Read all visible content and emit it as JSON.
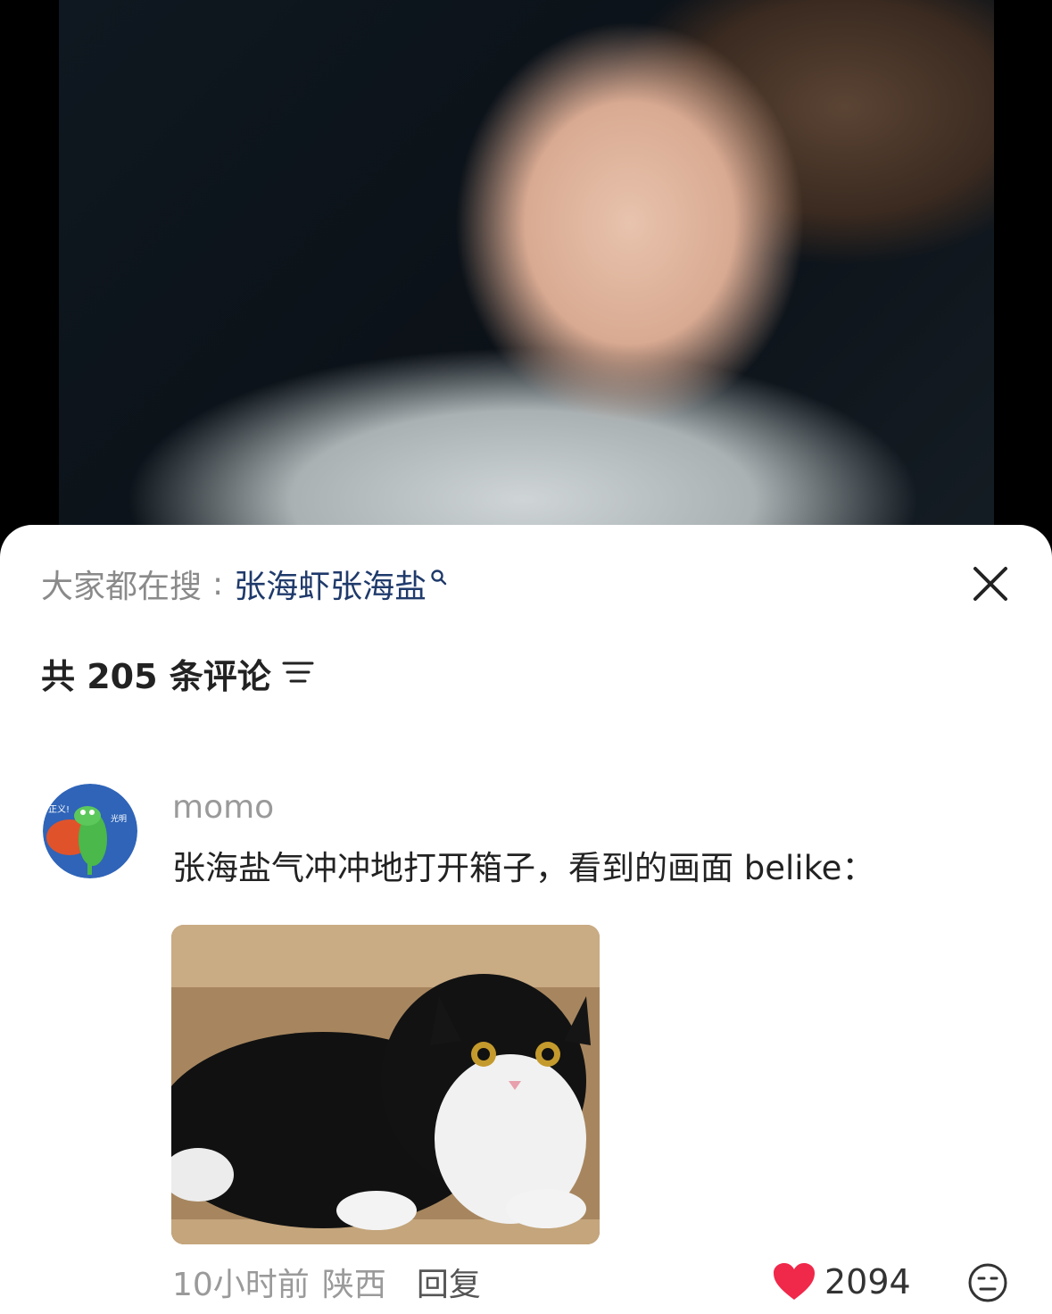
{
  "search_hint": {
    "prefix": "大家都在搜",
    "colon": ":",
    "term": "张海虾张海盐"
  },
  "comments_header": {
    "count_label": "共 205 条评论"
  },
  "comment": {
    "username": "momo",
    "avatar_text_left": "正义!",
    "avatar_text_right": "光明",
    "text": "张海盐气冲冲地打开箱子，看到的画面 belike：",
    "time": "10小时前",
    "location": "陕西",
    "reply_label": "回复",
    "likes": "2094"
  },
  "colors": {
    "accent_link": "#1f3a6b",
    "like_heart": "#f0284a",
    "sheet_bg": "#ffffff"
  },
  "icons": [
    "search-icon",
    "close-icon",
    "filter-icon",
    "heart-icon",
    "emoji-icon"
  ]
}
